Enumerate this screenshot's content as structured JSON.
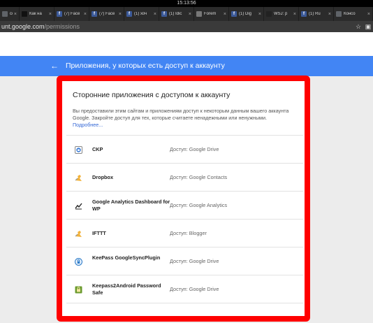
{
  "system": {
    "clock": "15:13:56"
  },
  "tabs": [
    {
      "label": "com",
      "icon": "generic-icon",
      "color": "#5f6368"
    },
    {
      "label": "Как на",
      "icon": "site-icon",
      "color": "#111111"
    },
    {
      "label": "(7) Face",
      "icon": "facebook-icon",
      "color": "#3b5998"
    },
    {
      "label": "(7) Face",
      "icon": "facebook-icon",
      "color": "#3b5998"
    },
    {
      "label": "(1) хоч",
      "icon": "facebook-icon",
      "color": "#3b5998"
    },
    {
      "label": "(1) Idic",
      "icon": "facebook-icon",
      "color": "#3b5998"
    },
    {
      "label": "Forem",
      "icon": "forum-icon",
      "color": "#777777"
    },
    {
      "label": "(1) Dig",
      "icon": "facebook-icon",
      "color": "#3b5998"
    },
    {
      "label": "WSJ: p",
      "icon": "wsj-icon",
      "color": "#222222"
    },
    {
      "label": "(1) Ru",
      "icon": "facebook-icon",
      "color": "#3b5998"
    },
    {
      "label": "Консо",
      "icon": "document-icon",
      "color": "#5f6368"
    }
  ],
  "address": {
    "host": "unt.google.com",
    "path": "/permissions"
  },
  "header": {
    "back_glyph": "←",
    "title": "Приложения, у которых есть доступ к аккаунту"
  },
  "card": {
    "title": "Сторонние приложения с доступом к аккаунту",
    "description": "Вы предоставили этим сайтам и приложениям доступ к некоторым данным вашего аккаунта Google. Закройте доступ для тех, которые считаете ненадежными или ненужными.",
    "more_link": "Подробнее..."
  },
  "apps": [
    {
      "name": "CKP",
      "access": "Доступ: Google Drive",
      "icon": "ckp-icon"
    },
    {
      "name": "Dropbox",
      "access": "Доступ: Google Contacts",
      "icon": "puzzle-icon"
    },
    {
      "name": "Google Analytics Dashboard for WP",
      "access": "Доступ: Google Analytics",
      "icon": "analytics-icon"
    },
    {
      "name": "IFTTT",
      "access": "Доступ: Blogger",
      "icon": "puzzle-icon"
    },
    {
      "name": "KeePass GoogleSyncPlugin",
      "access": "Доступ: Google Drive",
      "icon": "keepass-icon"
    },
    {
      "name": "Keepass2Android Password Safe",
      "access": "Доступ: Google Drive",
      "icon": "keepass2android-icon"
    }
  ],
  "colors": {
    "header": "#4285f4",
    "highlight": "#ff0000",
    "link": "#3367d6"
  }
}
